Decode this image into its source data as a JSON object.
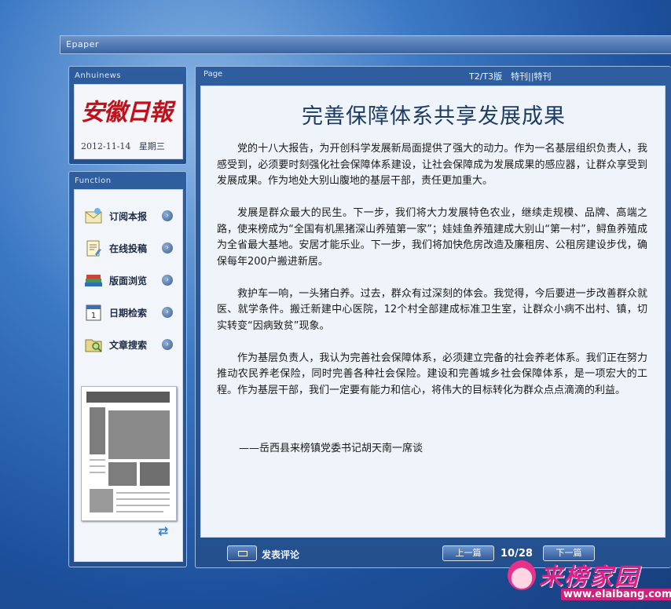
{
  "window": {
    "title": "Epaper"
  },
  "anhui": {
    "title": "Anhuinews",
    "logo": "安徽日報",
    "date": "2012-11-14",
    "weekday": "星期三"
  },
  "function": {
    "title": "Function",
    "items": [
      {
        "label": "订阅本报",
        "icon": "envelope-icon"
      },
      {
        "label": "在线投稿",
        "icon": "upload-document-icon"
      },
      {
        "label": "版面浏览",
        "icon": "books-icon"
      },
      {
        "label": "日期检索",
        "icon": "calendar-icon"
      },
      {
        "label": "文章搜索",
        "icon": "search-folder-icon"
      }
    ],
    "calendar_day": "1"
  },
  "page": {
    "label": "Page",
    "edition": "T2/T3版　特刊||特刊",
    "title": "完善保障体系共享发展成果",
    "paragraphs": [
      "党的十八大报告，为开创科学发展新局面提供了强大的动力。作为一名基层组织负责人，我感受到，必须要时刻强化社会保障体系建设，让社会保障成为发展成果的感应器，让群众享受到发展成果。作为地处大别山腹地的基层干部，责任更加重大。",
      "发展是群众最大的民生。下一步，我们将大力发展特色农业，继续走规模、品牌、高端之路，使来榜成为“全国有机黑猪深山养殖第一家”；娃娃鱼养殖建成大别山“第一村”，鲟鱼养殖成为全省最大基地。安居才能乐业。下一步，我们将加快危房改造及廉租房、公租房建设步伐，确保每年200户搬进新居。",
      "救护车一响，一头猪白养。过去，群众有过深刻的体会。我觉得，今后要进一步改善群众就医、就学条件。搬迁新建中心医院，12个村全部建成标准卫生室，让群众小病不出村、镇，切实转变“因病致贫”现象。",
      "作为基层负责人，我认为完善社会保障体系，必须建立完备的社会养老体系。我们正在努力推动农民养老保险，同时完善各种社会保险。建设和完善城乡社会保障体系，是一项宏大的工程。作为基层干部，我们一定要有能力和信心，将伟大的目标转化为群众点点滴滴的利益。"
    ],
    "signature": "——岳西县来榜镇党委书记胡天南一席谈"
  },
  "bottom": {
    "comment_label": "发表评论",
    "prev_label": "上一篇",
    "page_counter": "10/28",
    "next_label": "下一篇"
  },
  "watermark": {
    "text": "来榜家园",
    "url": "www.elaibang.com"
  },
  "colors": {
    "panel": "#2a5896",
    "accent_red": "#c0111b",
    "title_blue": "#1e3c62",
    "watermark_pink": "#e01e86"
  }
}
